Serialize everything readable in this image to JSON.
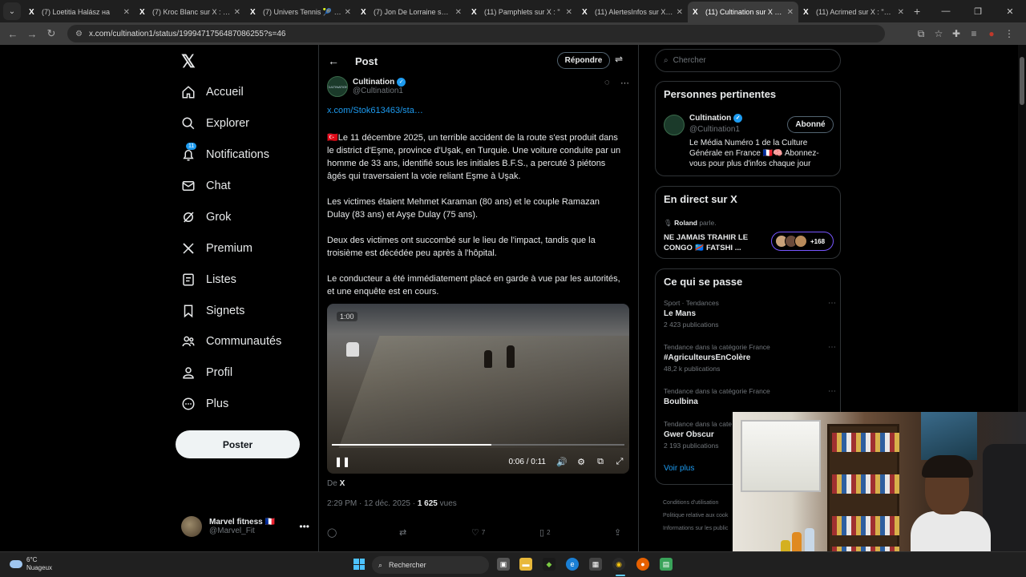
{
  "browser": {
    "tabs": [
      {
        "title": "(7) Loetitia Halász на",
        "icon": "X"
      },
      {
        "title": "(7) Kroc Blanc sur X : \"On",
        "icon": "X"
      },
      {
        "title": "(7) Univers Tennis 🎾 sur",
        "icon": "X"
      },
      {
        "title": "(7) Jon De Lorraine sur X",
        "icon": "X"
      },
      {
        "title": "(11) Pamphlets sur X : \"",
        "icon": "X"
      },
      {
        "title": "(11) AlertesInfos sur X : \"",
        "icon": "X"
      },
      {
        "title": "(11) Cultination sur X : \"Le",
        "icon": "X"
      },
      {
        "title": "(11) Acrimed sur X : \"Mise",
        "icon": "X"
      }
    ],
    "active_tab_index": 6,
    "url": "x.com/cultination1/status/1999471756487086255?s=46"
  },
  "nav": {
    "items": [
      {
        "label": "Accueil",
        "icon": "home-icon"
      },
      {
        "label": "Explorer",
        "icon": "search-icon"
      },
      {
        "label": "Notifications",
        "icon": "bell-icon",
        "badge": "11"
      },
      {
        "label": "Chat",
        "icon": "mail-icon"
      },
      {
        "label": "Grok",
        "icon": "grok-icon"
      },
      {
        "label": "Premium",
        "icon": "x-icon"
      },
      {
        "label": "Listes",
        "icon": "list-icon"
      },
      {
        "label": "Signets",
        "icon": "bookmark-icon"
      },
      {
        "label": "Communautés",
        "icon": "people-icon"
      },
      {
        "label": "Profil",
        "icon": "user-icon"
      },
      {
        "label": "Plus",
        "icon": "more-circle-icon"
      }
    ],
    "post_button": "Poster",
    "account": {
      "name": "Marvel fitness 🇫🇷",
      "handle": "@Marvel_Fit"
    }
  },
  "post": {
    "header_title": "Post",
    "reply_button": "Répondre",
    "author_name": "Cultination",
    "author_handle": "@Cultination1",
    "avatar_text": "CULTINATION",
    "link": "x.com/Stok613463/sta…",
    "paragraphs": [
      "🇹🇷Le 11 décembre 2025, un terrible accident de la route s'est produit dans le district d'Eşme, province d'Uşak, en Turquie. Une voiture conduite par un homme de 33 ans, identifié sous les initiales B.F.S., a percuté 3 piétons âgés qui traversaient la voie reliant Eşme à Uşak.",
      "Les victimes étaient Mehmet Karaman (80 ans) et le couple Ramazan Dulay (83 ans) et Ayşe Dulay (75 ans).",
      "Deux des victimes ont succombé sur le lieu de l'impact, tandis que la troisième est décédée peu après à l'hôpital.",
      "Le conducteur a été immédiatement placé en garde à vue par les autorités, et une enquête est en cours."
    ],
    "video": {
      "badge": "1:00",
      "time": "0:06 / 0:11",
      "progress": 0.545
    },
    "source_prefix": "De",
    "source_name": "X",
    "timestamp": "2:29 PM · 12 déc. 2025 · ",
    "views_count": "1 625",
    "views_label": " vues",
    "actions": {
      "replies": "",
      "reposts": "",
      "likes": "7",
      "bookmarks": "2"
    }
  },
  "sidebar": {
    "search_placeholder": "Chercher",
    "relevant": {
      "title": "Personnes pertinentes",
      "name": "Cultination",
      "handle": "@Cultination1",
      "follow_label": "Abonné",
      "bio": "Le Média Numéro 1 de la Culture Générale en France 🇫🇷🧠 Abonnez-vous pour plus d'infos chaque jour"
    },
    "live": {
      "title": "En direct sur X",
      "host": "Roland",
      "host_suffix": " parle.",
      "space_title": "NE JAMAIS TRAHIR LE CONGO 🇨🇩 FATSHI ...",
      "listeners": "+168"
    },
    "trends": {
      "title": "Ce qui se passe",
      "items": [
        {
          "category": "Sport · Tendances",
          "name": "Le Mans",
          "count": "2 423 publications"
        },
        {
          "category": "Tendance dans la catégorie France",
          "name": "#AgriculteursEnColère",
          "count": "48,2 k publications"
        },
        {
          "category": "Tendance dans la catégorie France",
          "name": "Boulbina",
          "count": ""
        },
        {
          "category": "Tendance dans la cate",
          "name": "Gwer Obscur",
          "count": "2 193 publications"
        }
      ],
      "show_more": "Voir plus"
    },
    "footer": [
      "Conditions d'utilisation",
      "Politique relative aux cook",
      "Informations sur les public"
    ]
  },
  "taskbar": {
    "weather_temp": "6°C",
    "weather_desc": "Nuageux",
    "search_label": "Rechercher"
  }
}
